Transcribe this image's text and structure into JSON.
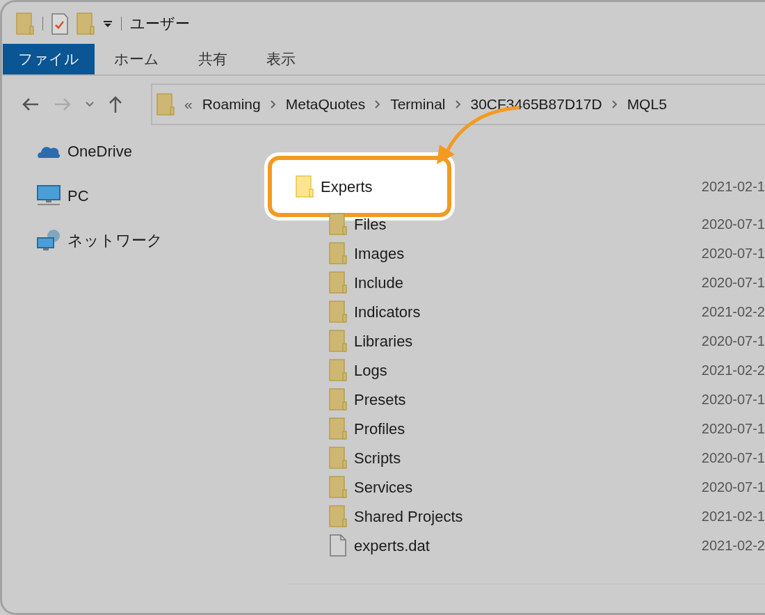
{
  "window": {
    "title": "ユーザー"
  },
  "ribbon_tabs": [
    {
      "label": "ファイル",
      "selected": true
    },
    {
      "label": "ホーム",
      "selected": false
    },
    {
      "label": "共有",
      "selected": false
    },
    {
      "label": "表示",
      "selected": false
    }
  ],
  "address_bar": {
    "overflow": "«",
    "path": [
      "Roaming",
      "MetaQuotes",
      "Terminal",
      "30CF3465B87D17D",
      "MQL5"
    ]
  },
  "navigation": [
    {
      "label": "OneDrive",
      "kind": "cloud"
    },
    {
      "label": "PC",
      "kind": "pc"
    },
    {
      "label": "ネットワーク",
      "kind": "network"
    }
  ],
  "files": [
    {
      "name": "Experts",
      "date": "2021-02-1",
      "kind": "folder",
      "highlighted": true
    },
    {
      "name": "Files",
      "date": "2020-07-1",
      "kind": "folder",
      "highlighted": false
    },
    {
      "name": "Images",
      "date": "2020-07-1",
      "kind": "folder",
      "highlighted": false
    },
    {
      "name": "Include",
      "date": "2020-07-1",
      "kind": "folder",
      "highlighted": false
    },
    {
      "name": "Indicators",
      "date": "2021-02-2",
      "kind": "folder",
      "highlighted": false
    },
    {
      "name": "Libraries",
      "date": "2020-07-1",
      "kind": "folder",
      "highlighted": false
    },
    {
      "name": "Logs",
      "date": "2021-02-2",
      "kind": "folder",
      "highlighted": false
    },
    {
      "name": "Presets",
      "date": "2020-07-1",
      "kind": "folder",
      "highlighted": false
    },
    {
      "name": "Profiles",
      "date": "2020-07-1",
      "kind": "folder",
      "highlighted": false
    },
    {
      "name": "Scripts",
      "date": "2020-07-1",
      "kind": "folder",
      "highlighted": false
    },
    {
      "name": "Services",
      "date": "2020-07-1",
      "kind": "folder",
      "highlighted": false
    },
    {
      "name": "Shared Projects",
      "date": "2021-02-1",
      "kind": "folder",
      "highlighted": false
    },
    {
      "name": "experts.dat",
      "date": "2021-02-2",
      "kind": "file",
      "highlighted": false
    }
  ]
}
